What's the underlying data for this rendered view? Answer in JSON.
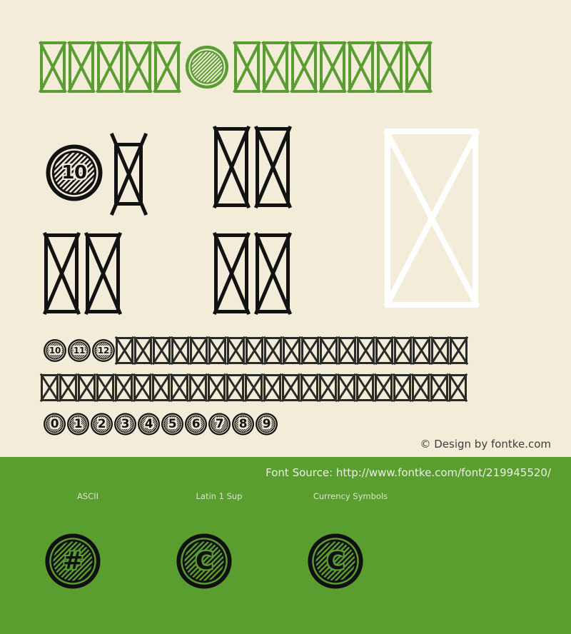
{
  "page": {
    "background_color": "#f2ecd9",
    "band_color": "#5a9e2f",
    "title_color": "#5a9e33",
    "glyph_color": "#121212",
    "white_glyph_color": "#ffffff"
  },
  "title": {
    "name": "font-title-preview",
    "description": "Font name rendered as missing-glyph boxes with one coin glyph",
    "segments": [
      {
        "kind": "tofu",
        "count": 5
      },
      {
        "kind": "coin",
        "label": ""
      },
      {
        "kind": "tofu",
        "count": 7
      }
    ]
  },
  "specimen": {
    "row1": {
      "coin_label": "10",
      "tofu_after_coin": 1,
      "group2_tofu": 2
    },
    "row2": {
      "group1_tofu": 2,
      "group2_tofu": 2
    },
    "white_box": {
      "name": "large-missing-glyph-box",
      "color": "#ffffff"
    }
  },
  "paragraph": {
    "line1_coins": [
      "10",
      "11",
      "12"
    ],
    "line1_tofu": 19,
    "line2_tofu": 23
  },
  "digits": {
    "values": [
      "0",
      "1",
      "2",
      "3",
      "4",
      "5",
      "6",
      "7",
      "8",
      "9"
    ]
  },
  "credit": {
    "text": "© Design by fontke.com"
  },
  "source": {
    "text": "Font Source: http://www.fontke.com/font/219945520/"
  },
  "unicode_blocks": [
    {
      "label": "ASCII",
      "sample_glyph": "#"
    },
    {
      "label": "Latin 1 Sup",
      "sample_glyph": "C"
    },
    {
      "label": "Currency Symbols",
      "sample_glyph": "C"
    }
  ]
}
